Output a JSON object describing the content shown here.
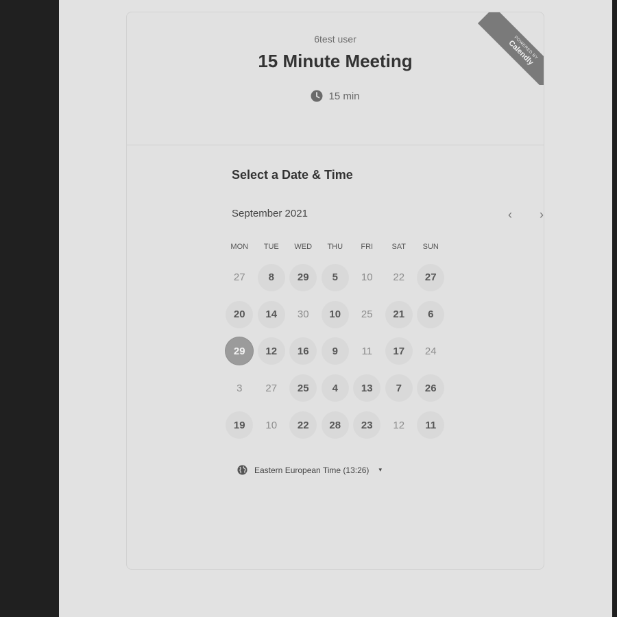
{
  "header": {
    "owner_name": "6test user",
    "event_title": "15 Minute Meeting",
    "duration": "15 min",
    "ribbon_small": "POWERED BY",
    "ribbon_brand": "Calendly"
  },
  "calendar": {
    "section_title": "Select a Date & Time",
    "month_label": "September 2021",
    "prev_label": "‹",
    "next_label": "›",
    "weekdays": [
      "MON",
      "TUE",
      "WED",
      "THU",
      "FRI",
      "SAT",
      "SUN"
    ],
    "weeks": [
      [
        {
          "d": "27",
          "s": "off"
        },
        {
          "d": "8",
          "s": "avail"
        },
        {
          "d": "29",
          "s": "avail"
        },
        {
          "d": "5",
          "s": "avail"
        },
        {
          "d": "10",
          "s": "off"
        },
        {
          "d": "22",
          "s": "off"
        },
        {
          "d": "27",
          "s": "avail"
        }
      ],
      [
        {
          "d": "20",
          "s": "avail"
        },
        {
          "d": "14",
          "s": "avail"
        },
        {
          "d": "30",
          "s": "off"
        },
        {
          "d": "10",
          "s": "avail"
        },
        {
          "d": "25",
          "s": "off"
        },
        {
          "d": "21",
          "s": "avail"
        },
        {
          "d": "6",
          "s": "avail"
        }
      ],
      [
        {
          "d": "29",
          "s": "selected"
        },
        {
          "d": "12",
          "s": "avail"
        },
        {
          "d": "16",
          "s": "avail"
        },
        {
          "d": "9",
          "s": "avail"
        },
        {
          "d": "11",
          "s": "off"
        },
        {
          "d": "17",
          "s": "avail"
        },
        {
          "d": "24",
          "s": "off"
        }
      ],
      [
        {
          "d": "3",
          "s": "off"
        },
        {
          "d": "27",
          "s": "off"
        },
        {
          "d": "25",
          "s": "avail"
        },
        {
          "d": "4",
          "s": "avail"
        },
        {
          "d": "13",
          "s": "avail"
        },
        {
          "d": "7",
          "s": "avail"
        },
        {
          "d": "26",
          "s": "avail"
        }
      ],
      [
        {
          "d": "19",
          "s": "avail"
        },
        {
          "d": "10",
          "s": "off"
        },
        {
          "d": "22",
          "s": "avail"
        },
        {
          "d": "28",
          "s": "avail"
        },
        {
          "d": "23",
          "s": "avail"
        },
        {
          "d": "12",
          "s": "off"
        },
        {
          "d": "11",
          "s": "avail"
        }
      ]
    ]
  },
  "timezone": {
    "label": "Eastern European Time (13:26)",
    "caret": "▾"
  }
}
